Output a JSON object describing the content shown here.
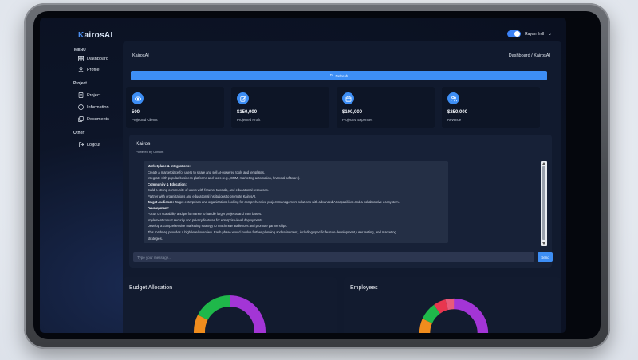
{
  "app": {
    "logo_first": "K",
    "logo_rest": "airosAI"
  },
  "topbar": {
    "username": "Rayan Ilrdl"
  },
  "sidebar": {
    "menu_heading": "MENU",
    "project_heading": "Project",
    "other_heading": "Other",
    "items": [
      {
        "label": "Dashboard",
        "icon": "grid-icon"
      },
      {
        "label": "Profile",
        "icon": "user-icon"
      },
      {
        "label": "Project",
        "icon": "document-icon"
      },
      {
        "label": "Information",
        "icon": "info-icon"
      },
      {
        "label": "Documents",
        "icon": "files-icon"
      },
      {
        "label": "Logout",
        "icon": "logout-icon"
      }
    ]
  },
  "breadcrumb": {
    "left": "KairosAI",
    "right": "Dashboard / KairosAI"
  },
  "refresh_label": "Refresh",
  "stats": [
    {
      "value": "500",
      "label": "Projected Clients",
      "icon": "eye-icon"
    },
    {
      "value": "$150,000",
      "label": "Projected Profit",
      "icon": "edit-icon"
    },
    {
      "value": "$100,000",
      "label": "Projected Expenses",
      "icon": "box-icon"
    },
    {
      "value": "$250,000",
      "label": "Revenue",
      "icon": "people-icon"
    }
  ],
  "chat": {
    "title": "Kairos",
    "subtitle": "Powered by Upfrom",
    "lines": [
      {
        "bold": "Marketplace & Integrations:",
        "text": ""
      },
      {
        "bold": "",
        "text": "Create a marketplace for users to share and sell AI-powered tools and templates."
      },
      {
        "bold": "",
        "text": "Integrate with popular business platforms and tools (e.g., CRM, marketing automation, financial software)."
      },
      {
        "bold": "Community & Education:",
        "text": ""
      },
      {
        "bold": "",
        "text": "Build a strong community of users with forums, tutorials, and educational resources."
      },
      {
        "bold": "",
        "text": "Partner with organizations and educational institutions to promote KairosAI."
      },
      {
        "bold": "Target Audience:",
        "text": " Target enterprises and organizations looking for comprehensive project management solutions with advanced AI capabilities and a collaborative ecosystem."
      },
      {
        "bold": "Development:",
        "text": ""
      },
      {
        "bold": "",
        "text": "Focus on scalability and performance to handle larger projects and user bases."
      },
      {
        "bold": "",
        "text": "Implement robust security and privacy features for enterprise-level deployments."
      },
      {
        "bold": "",
        "text": "Develop a comprehensive marketing strategy to reach new audiences and promote partnerships."
      },
      {
        "bold": "",
        "text": "This roadmap provides a high-level overview. Each phase would involve further planning and refinement, including specific feature development, user testing, and marketing"
      },
      {
        "bold": "",
        "text": "strategies."
      }
    ],
    "input_placeholder": "Type your message...",
    "send_label": "Send"
  },
  "cards": {
    "budget_title": "Budget Allocation",
    "employees_title": "Employees"
  },
  "colors": {
    "accent": "#3d8ef5",
    "donut_purple": "#a335d6",
    "donut_green": "#1fb84a",
    "donut_orange": "#f08c1d",
    "donut_red": "#e8364f",
    "donut_pink": "#e85a7a"
  }
}
